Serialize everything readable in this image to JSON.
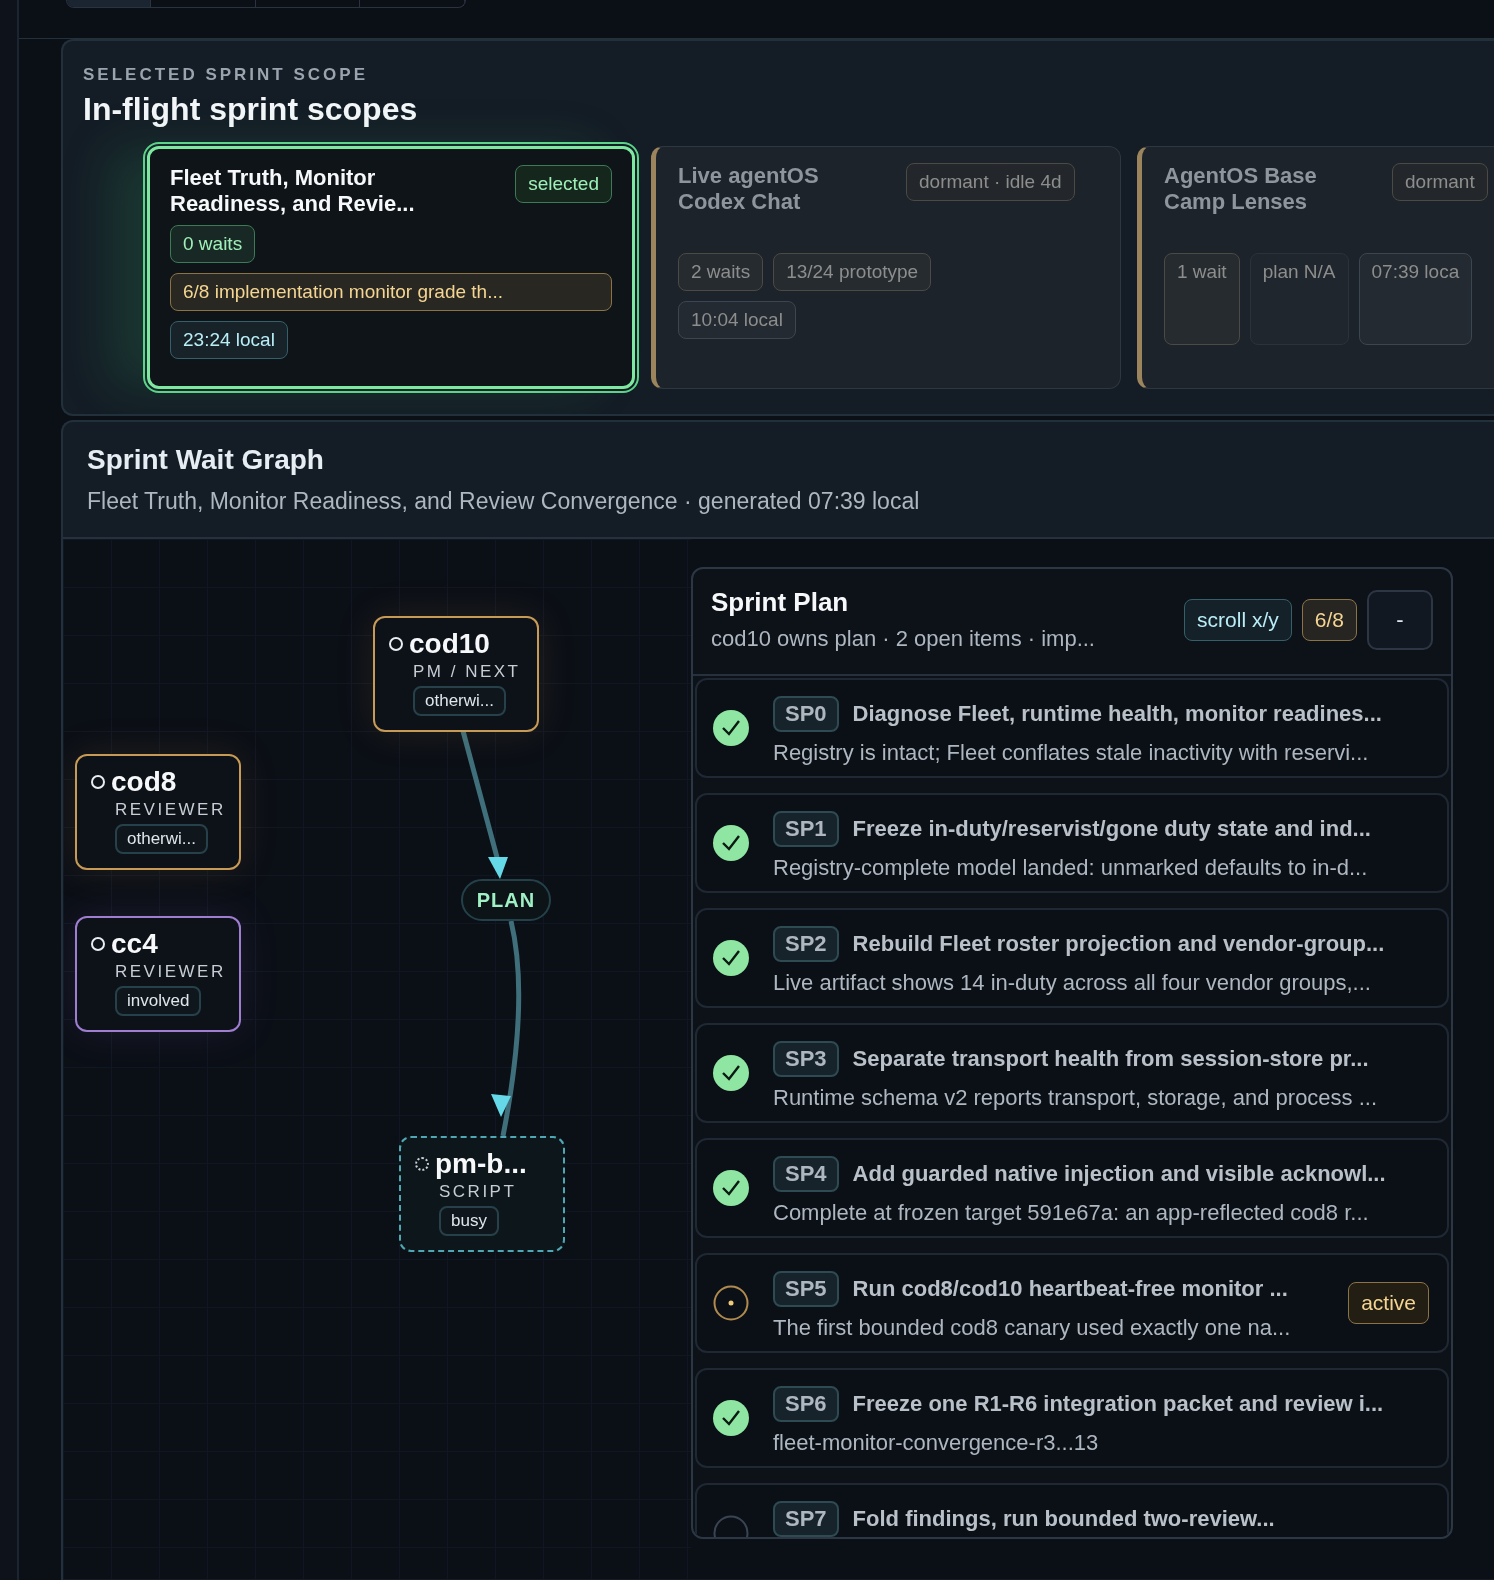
{
  "scopes": {
    "eyebrow": "SELECTED SPRINT SCOPE",
    "title": "In-flight sprint scopes",
    "cards": [
      {
        "title": "Fleet Truth, Monitor Readiness, and Revie...",
        "status": "selected",
        "selected": true,
        "chips": [
          {
            "text": "0 waits",
            "color": "#3d7a55"
          },
          {
            "text": "6/8 implementation monitor grade th...",
            "color": "#8c7346"
          },
          {
            "text": "23:24 local",
            "color": "#35606a"
          }
        ]
      },
      {
        "title": "Live agentOS Codex Chat",
        "status": "dormant · idle 4d",
        "selected": false,
        "chips": [
          {
            "text": "2 waits",
            "color": "#4b4a44"
          },
          {
            "text": "13/24 prototype",
            "color": "#4b4a44"
          },
          {
            "text": "10:04 local",
            "color": "#3c4650"
          }
        ]
      },
      {
        "title": "AgentOS Base Camp Lenses",
        "status": "dormant",
        "selected": false,
        "chips": [
          {
            "text": "1 wait",
            "color": "#4b4a44"
          },
          {
            "text": "plan N/A",
            "color": "#2d3238"
          },
          {
            "text": "07:39 loca",
            "color": "#3c4650"
          }
        ]
      }
    ]
  },
  "graph": {
    "title": "Sprint Wait Graph",
    "subtitle": "Fleet Truth, Monitor Readiness, and Review Convergence · generated 07:39 local",
    "nodes": [
      {
        "name": "cod10",
        "role": "PM / NEXT",
        "chip": "otherwi...",
        "kind": "amber"
      },
      {
        "name": "cod8",
        "role": "REVIEWER",
        "chip": "otherwi...",
        "kind": "amber"
      },
      {
        "name": "cc4",
        "role": "REVIEWER",
        "chip": "involved",
        "kind": "purple"
      },
      {
        "name": "pm-b...",
        "role": "SCRIPT",
        "chip": "busy",
        "kind": "script"
      }
    ],
    "gate": "PLAN"
  },
  "plan": {
    "title": "Sprint Plan",
    "subtitle": "cod10 owns plan · 2 open items · imp...",
    "chips": [
      {
        "text": "scroll x/y",
        "color": "#35606a"
      },
      {
        "text": "6/8",
        "color": "#8c7346"
      }
    ],
    "button": "-",
    "items": [
      {
        "id": "SP0",
        "title": "Diagnose Fleet, runtime health, monitor readines...",
        "note": "Registry is intact; Fleet conflates stale inactivity with reservi...",
        "kind": "done"
      },
      {
        "id": "SP1",
        "title": "Freeze in-duty/reservist/gone duty state and ind...",
        "note": "Registry-complete model landed: unmarked defaults to in-d...",
        "kind": "done"
      },
      {
        "id": "SP2",
        "title": "Rebuild Fleet roster projection and vendor-group...",
        "note": "Live artifact shows 14 in-duty across all four vendor groups,...",
        "kind": "done"
      },
      {
        "id": "SP3",
        "title": "Separate transport health from session-store pr...",
        "note": "Runtime schema v2 reports transport, storage, and process ...",
        "kind": "done"
      },
      {
        "id": "SP4",
        "title": "Add guarded native injection and visible acknowl...",
        "note": "Complete at frozen target 591e67a: an app-reflected cod8 r...",
        "kind": "done"
      },
      {
        "id": "SP5",
        "title": "Run cod8/cod10 heartbeat-free monitor ...",
        "note": "The first bounded cod8 canary used exactly one na...",
        "kind": "active",
        "badge": "active"
      },
      {
        "id": "SP6",
        "title": "Freeze one R1-R6 integration packet and review i...",
        "note": "fleet-monitor-convergence-r3...13",
        "kind": "done"
      },
      {
        "id": "SP7",
        "title": "Fold findings, run bounded two-review...",
        "kind": "pending"
      }
    ]
  }
}
